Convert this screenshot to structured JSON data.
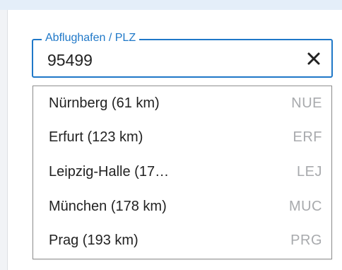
{
  "airport_field": {
    "label": "Abflughafen / PLZ",
    "value": "95499",
    "clear_icon": "close-icon"
  },
  "suggestions": [
    {
      "name": "Nürnberg (61 km)",
      "code": "NUE"
    },
    {
      "name": "Erfurt (123 km)",
      "code": "ERF"
    },
    {
      "name": "Leipzig-Halle (17…",
      "code": "LEJ"
    },
    {
      "name": "München (178 km)",
      "code": "MUC"
    },
    {
      "name": "Prag (193 km)",
      "code": "PRG"
    }
  ],
  "colors": {
    "accent": "#1f78c8",
    "code_text": "#a8aaad"
  }
}
